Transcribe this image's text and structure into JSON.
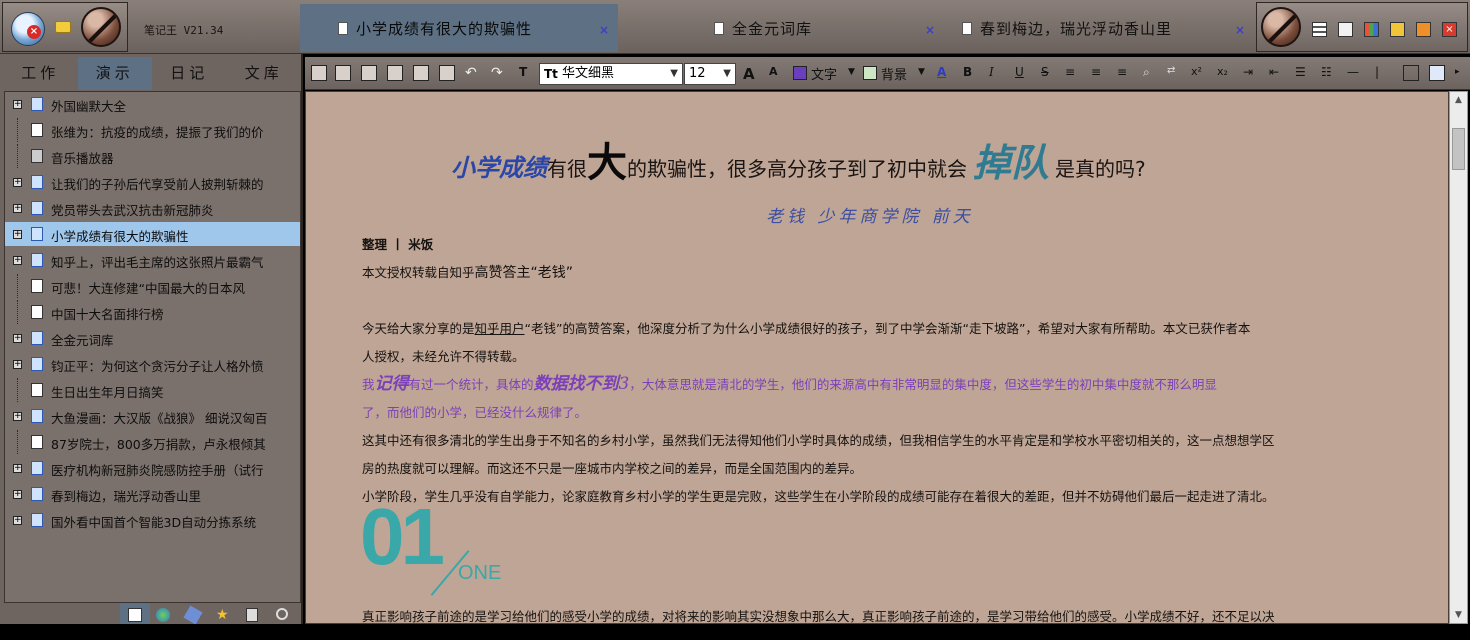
{
  "app": {
    "title": "笔记王 V21.34"
  },
  "doc_tabs": [
    {
      "label": "小学成绩有很大的欺骗性",
      "active": true,
      "close": "×"
    },
    {
      "label": "全金元词库",
      "active": false,
      "close": "×"
    },
    {
      "label": "春到梅边，瑞光浮动香山里",
      "active": false,
      "close": "×"
    }
  ],
  "left_tabs": [
    {
      "label": "工作",
      "active": false
    },
    {
      "label": "演示",
      "active": true
    },
    {
      "label": "日记",
      "active": false
    },
    {
      "label": "文库",
      "active": false
    }
  ],
  "tree": [
    {
      "label": "外国幽默大全",
      "expandable": true,
      "selected": false
    },
    {
      "label": "张维为：抗疫的成绩，提振了我们的价",
      "expandable": false,
      "selected": false
    },
    {
      "label": "音乐播放器",
      "expandable": false,
      "selected": false
    },
    {
      "label": "让我们的子孙后代享受前人披荆斩棘的",
      "expandable": true,
      "selected": false
    },
    {
      "label": "党员带头去武汉抗击新冠肺炎",
      "expandable": true,
      "selected": false
    },
    {
      "label": "小学成绩有很大的欺骗性",
      "expandable": true,
      "selected": true
    },
    {
      "label": "知乎上，评出毛主席的这张照片最霸气",
      "expandable": true,
      "selected": false
    },
    {
      "label": "可悲！大连修建“中国最大的日本风",
      "expandable": false,
      "selected": false
    },
    {
      "label": "中国十大名面排行榜",
      "expandable": false,
      "selected": false
    },
    {
      "label": "全金元词库",
      "expandable": true,
      "selected": false
    },
    {
      "label": "钧正平：为何这个贪污分子让人格外愤",
      "expandable": true,
      "selected": false
    },
    {
      "label": "生日出生年月日搞笑",
      "expandable": false,
      "selected": false
    },
    {
      "label": "大鱼漫画：大汉版《战狼》 细说汉匈百",
      "expandable": true,
      "selected": false
    },
    {
      "label": "87岁院士，800多万捐款，卢永根倾其",
      "expandable": false,
      "selected": false
    },
    {
      "label": "医疗机构新冠肺炎院感防控手册（试行",
      "expandable": true,
      "selected": false
    },
    {
      "label": "春到梅边，瑞光浮动香山里",
      "expandable": true,
      "selected": false
    },
    {
      "label": "国外看中国首个智能3D自动分拣系统",
      "expandable": true,
      "selected": false
    }
  ],
  "toolbar": {
    "font_name": "华文细黑",
    "font_size": "12",
    "text_color_label": "文字",
    "bg_color_label": "背景",
    "text_color": "#6a3fbe",
    "bg_color": "#cde7c5",
    "bold": "B",
    "italic": "I",
    "underline": "U",
    "strike": "S",
    "font_icon_label": "Tt",
    "sup": "x²",
    "sub": "x₂"
  },
  "article": {
    "headline_part1": "小学成绩",
    "headline_part2": "有很",
    "headline_part3": "大",
    "headline_part4": "的欺骗性，很多高分孩子到了初中就会",
    "headline_part5": "掉队",
    "headline_part6": "是真的吗?",
    "byline": "老钱 少年商学院 前天",
    "editor_line": "整理 丨 米饭",
    "source_line_a": "本文授权转载自知乎",
    "source_line_b": "高赞答主“老钱”",
    "para1_a": "今天给大家分享的是",
    "para1_link": "知乎用户",
    "para1_b": "“老钱”的高赞答案，他深度分析了为什么小学成绩很好的孩子，到了中学会渐渐“走下坡路”，希望对大家有所帮助。本文已获作者本",
    "para1_c": "人授权，未经允许不得转载。",
    "para2_a": "我",
    "para2_emph1": "记得",
    "para2_b": "有过一个统计，具体的",
    "para2_emph2": "数据找不到",
    "para2_emph3": "3",
    "para2_c": "，大体意思就是清北的学生，他们的来源高中有非常明显的集中度，但这些学生的初中集中度就不那么明显",
    "para2_d": "了，而他们的小学，已经没什么规律了。",
    "para3_a": "这其中还有很多清北的学生出身于不知名的乡村小学，虽然我们无法得知他们小学时具体的成绩，但我相信学生的水平肯定是和学校水平密切相关的，这一点想想学区",
    "para3_b": "房的热度就可以理解。而这还不只是一座城市内学校之间的差异，而是全国范围内的差异。",
    "para4": "小学阶段，学生几乎没有自学能力，论家庭教育乡村小学的学生更是完败，这些学生在小学阶段的成绩可能存在着很大的差距，但并不妨碍他们最后一起走进了清北。",
    "section_number": "01",
    "section_word": "ONE",
    "para5": "真正影响孩子前途的是学习给他们的感受小学的成绩，对将来的影响其实没想象中那么大，真正影响孩子前途的，是学习带给他们的感受。小学成绩不好，还不足以决"
  }
}
